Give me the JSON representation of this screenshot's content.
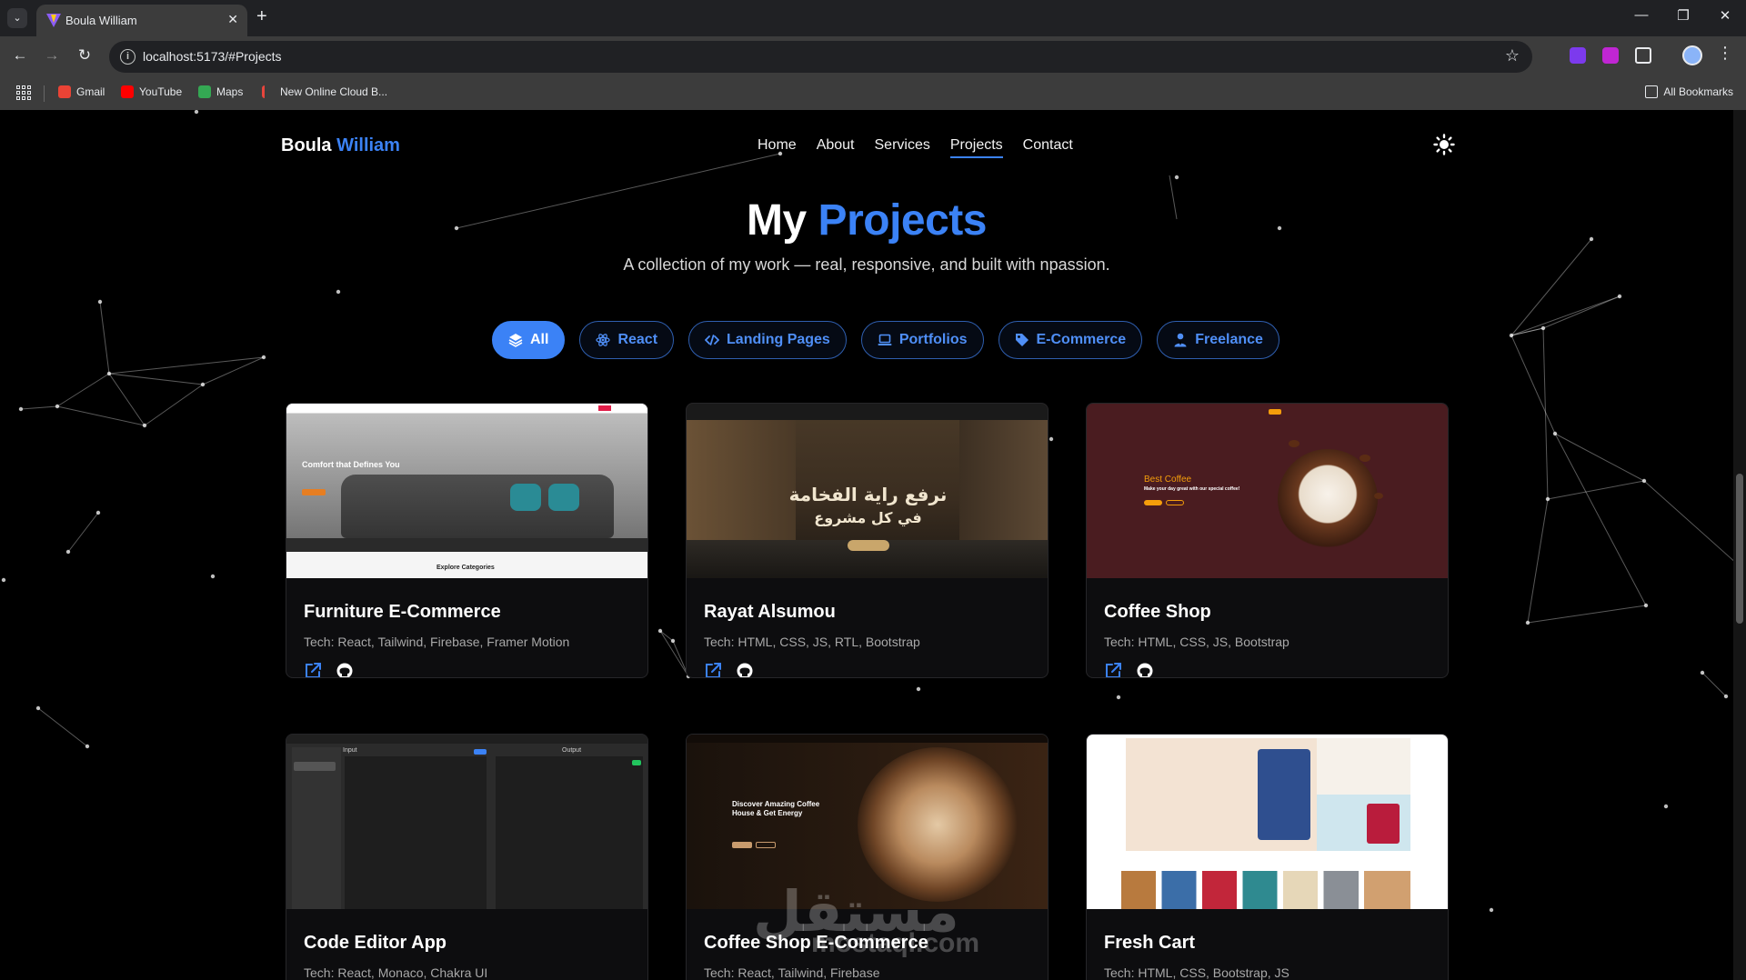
{
  "browser": {
    "tab_title": "Boula William",
    "url": "localhost:5173/#Projects",
    "bookmarks": [
      {
        "label": "Gmail",
        "color": "#ea4335"
      },
      {
        "label": "YouTube",
        "color": "#ff0000"
      },
      {
        "label": "Maps",
        "color": "#34a853"
      },
      {
        "label": "New Online Cloud B...",
        "color": "#e8453c"
      }
    ],
    "all_bookmarks": "All Bookmarks"
  },
  "site": {
    "logo_first": "Boula",
    "logo_second": "William",
    "nav": [
      "Home",
      "About",
      "Services",
      "Projects",
      "Contact"
    ],
    "active_nav": "Projects",
    "accent": "#3b82f6"
  },
  "hero": {
    "title_first": "My",
    "title_second": "Projects",
    "subtitle": "A collection of my work — real, responsive, and built with npassion."
  },
  "filters": [
    {
      "label": "All",
      "icon": "layers-icon",
      "active": true
    },
    {
      "label": "React",
      "icon": "atom-icon",
      "active": false
    },
    {
      "label": "Landing Pages",
      "icon": "code-icon",
      "active": false
    },
    {
      "label": "Portfolios",
      "icon": "laptop-icon",
      "active": false
    },
    {
      "label": "E-Commerce",
      "icon": "tag-icon",
      "active": false
    },
    {
      "label": "Freelance",
      "icon": "user-tie-icon",
      "active": false
    }
  ],
  "projects": [
    {
      "title": "Furniture E-Commerce",
      "tech": "Tech: React, Tailwind, Firebase, Framer Motion",
      "preview_heading": "Comfort that Defines You",
      "preview_footer": "Explore Categories"
    },
    {
      "title": "Rayat Alsumou",
      "tech": "Tech: HTML, CSS, JS, RTL, Bootstrap",
      "preview_heading": "نرفع راية الفخامة",
      "preview_sub": "في كل مشروع"
    },
    {
      "title": "Coffee Shop",
      "tech": "Tech: HTML, CSS, JS, Bootstrap",
      "preview_heading": "Best Coffee",
      "preview_sub": "Make your day great with our special coffee!"
    },
    {
      "title": "Code Editor App",
      "tech": "Tech: React, Monaco, Chakra UI",
      "preview_input": "Input",
      "preview_output": "Output"
    },
    {
      "title": "Coffee Shop E-Commerce",
      "tech": "Tech: React, Tailwind, Firebase",
      "preview_heading": "Discover Amazing Coffee House & Get Energy"
    },
    {
      "title": "Fresh Cart",
      "tech": "Tech: HTML, CSS, Bootstrap, JS"
    }
  ],
  "watermark": {
    "arabic": "مستقل",
    "latin": "mostaql.com"
  }
}
